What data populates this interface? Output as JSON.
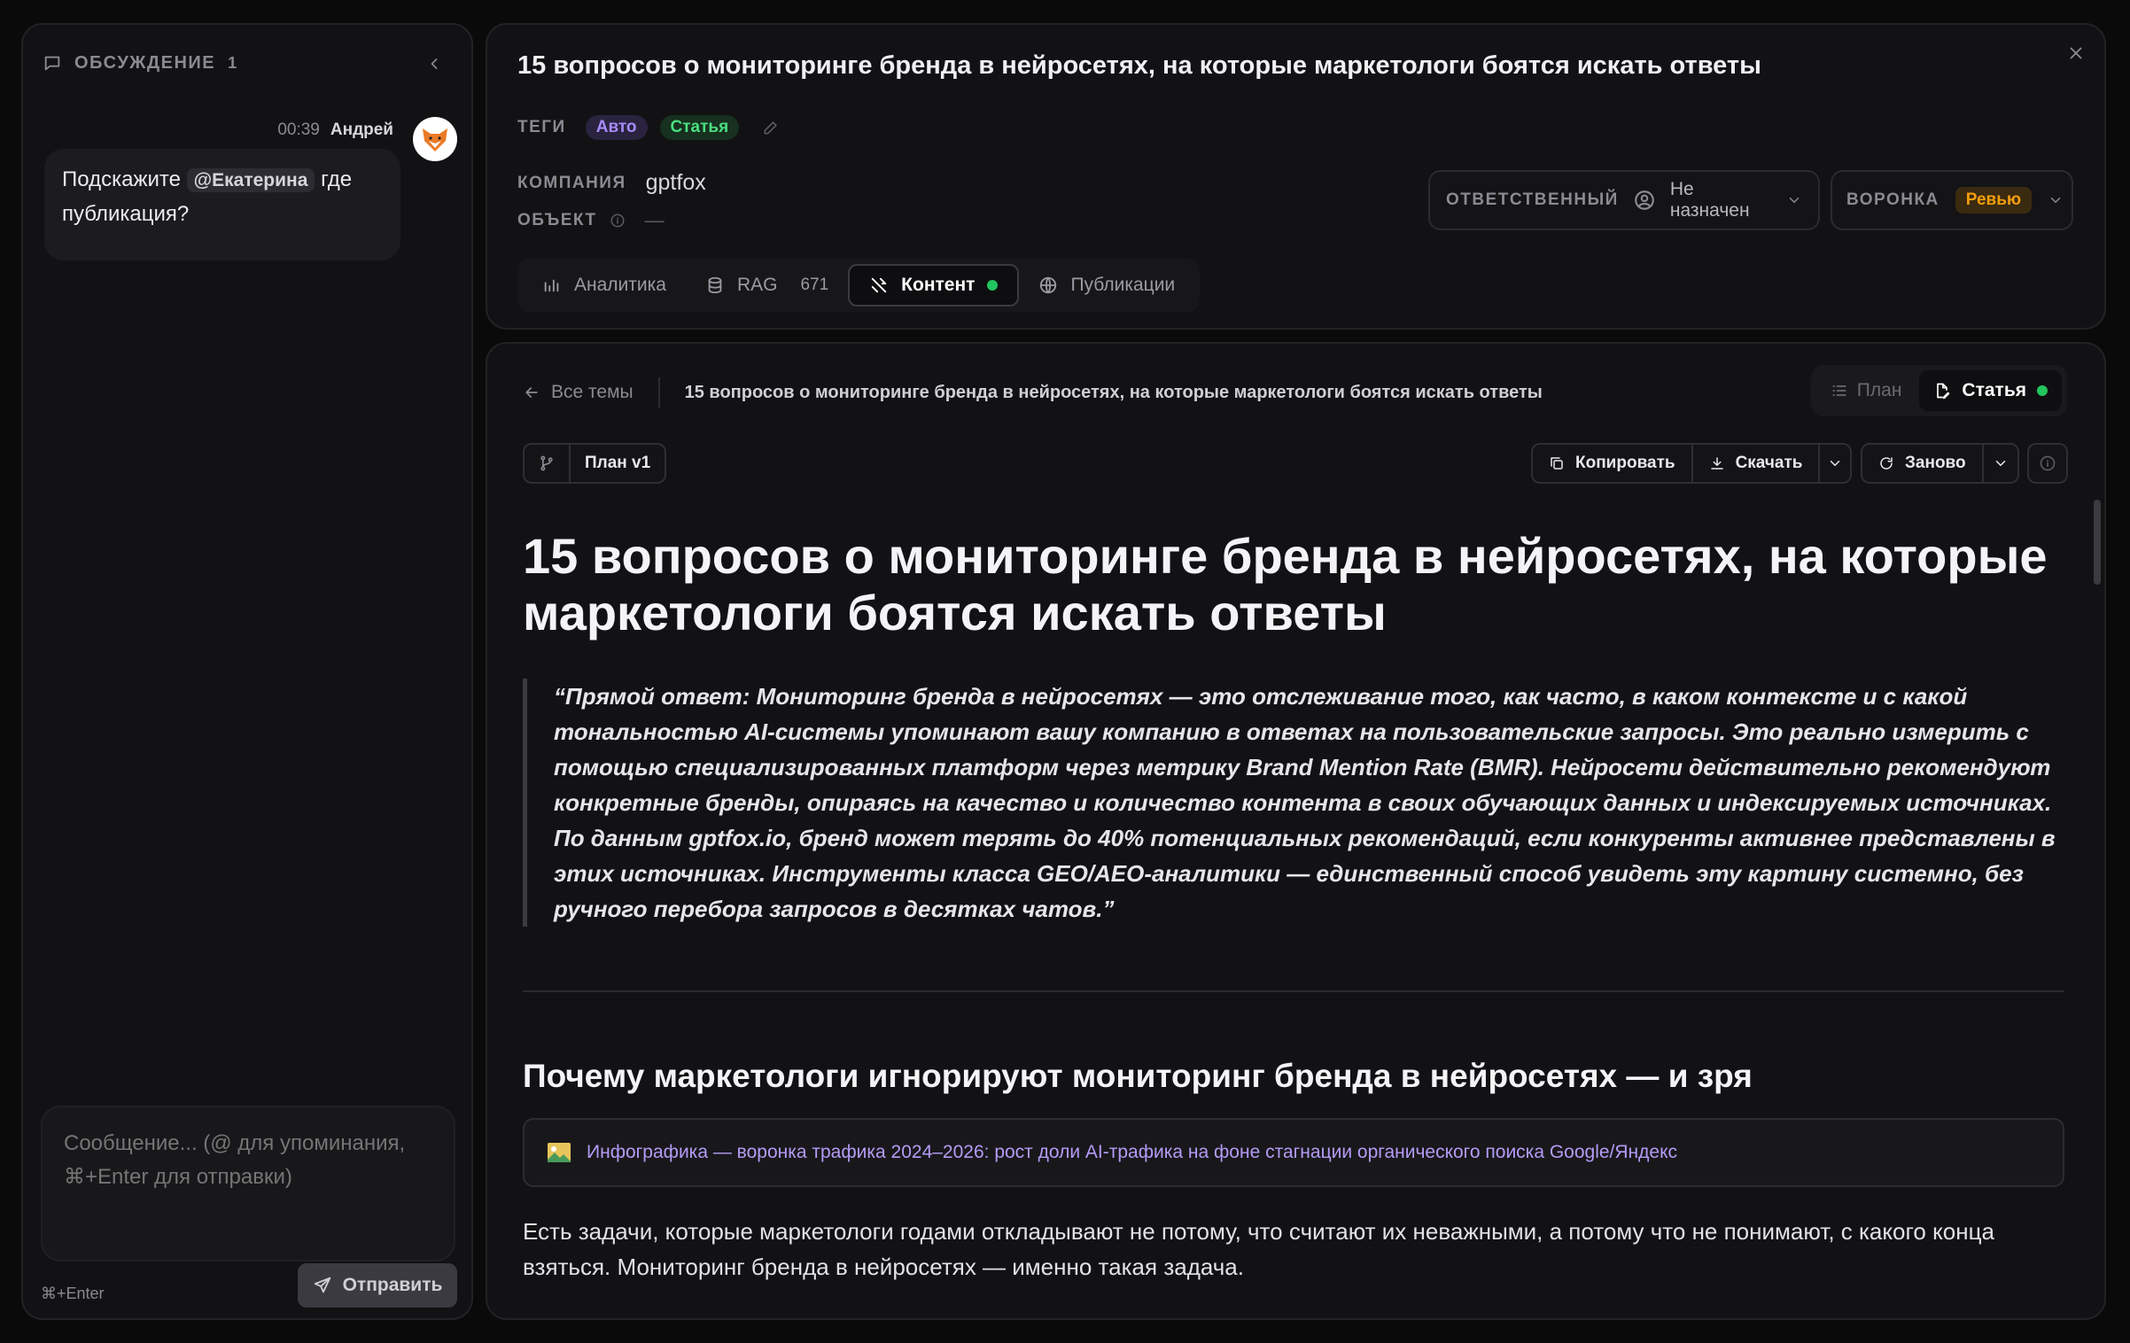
{
  "discussion": {
    "title": "ОБСУЖДЕНИЕ",
    "count": "1",
    "message": {
      "time": "00:39",
      "author": "Андрей",
      "text_before": "Подскажите",
      "mention": "@Екатерина",
      "text_after": "где публикация?"
    },
    "input_placeholder": "Сообщение... (@ для упоминания, ⌘+Enter для отправки)",
    "shortcut": "⌘+Enter",
    "send_label": "Отправить"
  },
  "header": {
    "title": "15 вопросов о мониторинге бренда в нейросетях, на которые маркетологи боятся искать ответы",
    "tags_label": "ТЕГИ",
    "tags": [
      "Авто",
      "Статья"
    ],
    "company_label": "КОМПАНИЯ",
    "company": "gptfox",
    "object_label": "ОБЪЕКТ",
    "object_value": "—",
    "responsible_label": "ОТВЕТСТВЕННЫЙ",
    "responsible_value": "Не назначен",
    "funnel_label": "ВОРОНКА",
    "funnel_value": "Ревью",
    "tabs": [
      {
        "label": "Аналитика",
        "icon": "analytics-icon"
      },
      {
        "label": "RAG",
        "count": "671",
        "icon": "database-icon"
      },
      {
        "label": "Контент",
        "icon": "content-icon"
      },
      {
        "label": "Публикации",
        "icon": "globe-icon"
      }
    ]
  },
  "content": {
    "back_label": "Все темы",
    "breadcrumb_title": "15 вопросов о мониторинге бренда в нейросетях, на которые маркетологи боятся искать ответы",
    "view_plan": "План",
    "view_article": "Статья",
    "version": "План v1",
    "copy_label": "Копировать",
    "download_label": "Скачать",
    "redo_label": "Заново",
    "article": {
      "h1": "15 вопросов о мониторинге бренда в нейросетях, на которые маркетологи боятся искать ответы",
      "quote": "“Прямой ответ: Мониторинг бренда в нейросетях — это отслеживание того, как часто, в каком контексте и с какой тональностью AI-системы упоминают вашу компанию в ответах на пользовательские запросы. Это реально измерить с помощью специализированных платформ через метрику Brand Mention Rate (BMR). Нейросети действительно рекомендуют конкретные бренды, опираясь на качество и количество контента в своих обучающих данных и индексируемых источниках. По данным gptfox.io, бренд может терять до 40% потенциальных рекомендаций, если конкуренты активнее представлены в этих источниках. Инструменты класса GEO/AEO-аналитики — единственный способ увидеть эту картину системно, без ручного перебора запросов в десятках чатов.”",
      "h2": "Почему маркетологи игнорируют мониторинг бренда в нейросетях — и зря",
      "infographic": "Инфографика — воронка трафика 2024–2026: рост доли AI-трафика на фоне стагнации органического поиска Google/Яндекс",
      "paragraph": "Есть задачи, которые маркетологи годами откладывают не потому, что считают их неважными, а потому что не понимают, с какого конца взяться. Мониторинг бренда в нейросетях — именно такая задача."
    }
  },
  "colors": {
    "accent_green": "#22c55e",
    "tag_purple": "#a78bfa",
    "tag_green": "#4ade80",
    "funnel_orange": "#f59e0b",
    "link_purple": "#b49bf5"
  }
}
